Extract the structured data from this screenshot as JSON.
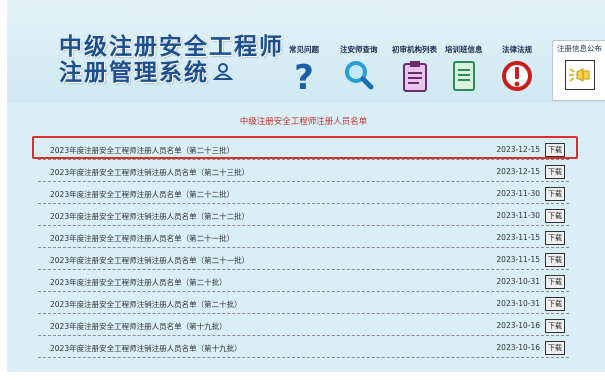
{
  "header": {
    "title_line1": "中级注册安全工程师",
    "title_line2": "注册管理系统",
    "user_icon": "user-icon"
  },
  "nav": [
    {
      "label": "常见问题",
      "icon": "question-icon"
    },
    {
      "label": "注安师查询",
      "icon": "magnifier-icon"
    },
    {
      "label": "初审机构列表",
      "icon": "clipboard-icon"
    },
    {
      "label": "培训班信息",
      "icon": "document-icon"
    },
    {
      "label": "法律法规",
      "icon": "alert-icon"
    },
    {
      "label": "注册信息公布",
      "icon": "announcement-icon"
    }
  ],
  "list": {
    "title": "中级注册安全工程师注册人员名单",
    "download_label": "下载",
    "rows": [
      {
        "name": "2023年度注册安全工程师注册人员名单（第二十三批）",
        "date": "2023-12-15"
      },
      {
        "name": "2023年度注册安全工程师注销注册人员名单（第二十三批）",
        "date": "2023-12-15"
      },
      {
        "name": "2023年度注册安全工程师注册人员名单（第二十二批）",
        "date": "2023-11-30"
      },
      {
        "name": "2023年度注册安全工程师注销注册人员名单（第二十二批）",
        "date": "2023-11-30"
      },
      {
        "name": "2023年度注册安全工程师注册人员名单（第二十一批）",
        "date": "2023-11-15"
      },
      {
        "name": "2023年度注册安全工程师注销注册人员名单（第二十一批）",
        "date": "2023-11-15"
      },
      {
        "name": "2023年度注册安全工程师注册人员名单（第二十批）",
        "date": "2023-10-31"
      },
      {
        "name": "2023年度注册安全工程师注销注册人员名单（第二十批）",
        "date": "2023-10-31"
      },
      {
        "name": "2023年度注册安全工程师注册人员名单（第十九批）",
        "date": "2023-10-16"
      },
      {
        "name": "2023年度注册安全工程师注销注册人员名单（第十九批）",
        "date": "2023-10-16"
      }
    ]
  },
  "colors": {
    "background": "#d9eef6",
    "title_blue": "#1d4f8e",
    "list_title_red": "#c0322a",
    "selection_red": "#d9302b"
  }
}
